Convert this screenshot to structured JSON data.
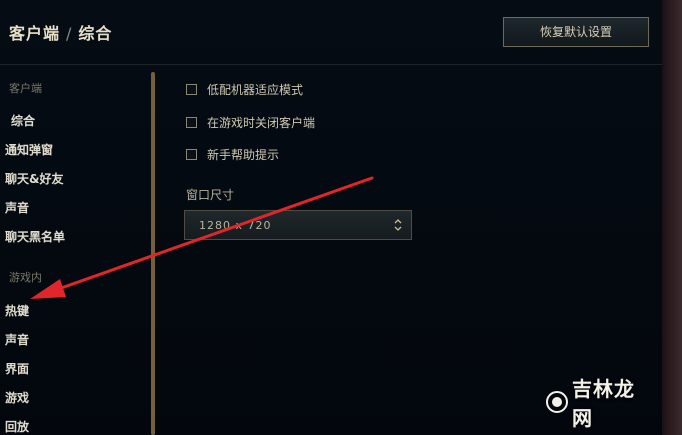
{
  "header": {
    "breadcrumb_parent": "客户端",
    "breadcrumb_separator": "/",
    "page_title": "综合",
    "restore_button": "恢复默认设置"
  },
  "sidebar": {
    "client_section_label": "客户端",
    "client_items": [
      "综合",
      "通知弹窗",
      "聊天&好友",
      "声音",
      "聊天黑名单"
    ],
    "ingame_section_label": "游戏内",
    "ingame_items": [
      "热键",
      "声音",
      "界面",
      "游戏",
      "回放"
    ]
  },
  "options": [
    {
      "label": "低配机器适应模式",
      "checked": false
    },
    {
      "label": "在游戏时关闭客户端",
      "checked": false
    },
    {
      "label": "新手帮助提示",
      "checked": false
    }
  ],
  "window_size": {
    "label": "窗口尺寸",
    "value": "1280 x 720"
  },
  "watermark": {
    "text": "吉林龙网"
  },
  "colors": {
    "background": "#010a13",
    "gold_accent": "#75603a",
    "annotation_arrow": "#e0262b",
    "text_primary": "#e0dccd"
  }
}
